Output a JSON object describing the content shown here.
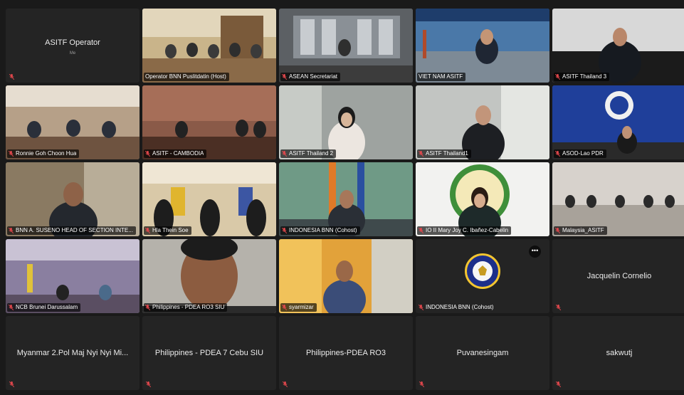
{
  "tiles": [
    {
      "name": "ASITF Operator",
      "sub": "Me"
    },
    {
      "name": "Operator BNN Puslitdatin (Host)"
    },
    {
      "name": "ASEAN Secretariat"
    },
    {
      "name": "VIET NAM ASITF"
    },
    {
      "name": "ASITF Thailand 3"
    },
    {
      "name": "Ronnie Goh Choon Hua"
    },
    {
      "name": "ASITF - CAMBODIA"
    },
    {
      "name": "ASITF Thailand 2"
    },
    {
      "name": "ASITF Thailand1"
    },
    {
      "name": "ASOD-Lao PDR"
    },
    {
      "name": "BNN A. SUSENO HEAD OF SECTION INTE..."
    },
    {
      "name": "Hla Thein Soe"
    },
    {
      "name": "INDONESIA BNN (Cohost)"
    },
    {
      "name": "IO II Mary Joy C. Ibañez-Cabelin"
    },
    {
      "name": "Malaysia_ASITF"
    },
    {
      "name": "NCB Brunei Darussalam"
    },
    {
      "name": "Philippines - PDEA RO3 SIU"
    },
    {
      "name": "syarmizar"
    },
    {
      "name": "INDONESIA BNN (Cohost)"
    },
    {
      "name": "Jacquelin Cornelio"
    },
    {
      "name": "Myanmar 2.Pol Maj Nyi Nyi Mi..."
    },
    {
      "name": "Philippines - PDEA 7 Cebu SIU"
    },
    {
      "name": "Philippines-PDEA RO3"
    },
    {
      "name": "Puvanesingam"
    },
    {
      "name": "sakwutj"
    }
  ],
  "more_button": "•••",
  "colors": {
    "mute": "#e5484d",
    "active_border": "#5aa8ff"
  }
}
